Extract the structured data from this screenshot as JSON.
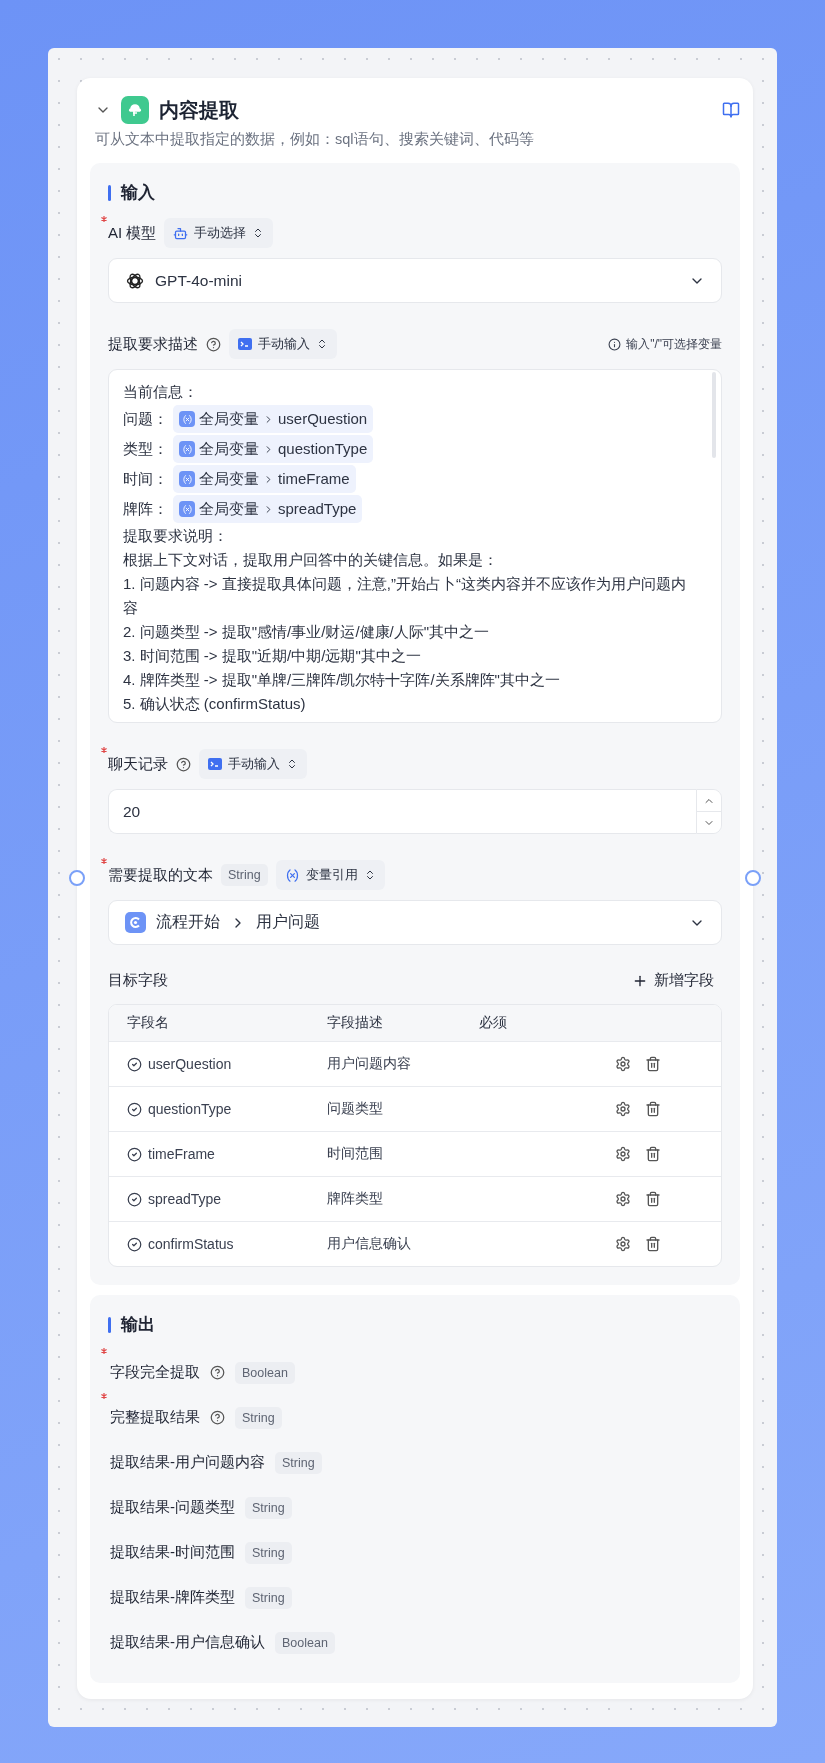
{
  "node": {
    "title": "内容提取",
    "description": "可从文本中提取指定的数据，例如：sql语句、搜索关键词、代码等"
  },
  "input": {
    "title": "输入",
    "ai_model": {
      "label": "AI 模型",
      "required": true,
      "mode": "手动选择",
      "value": "GPT-4o-mini"
    },
    "prompt": {
      "label": "提取要求描述",
      "required": false,
      "mode": "手动输入",
      "hint": "输入\"/\"可选择变量",
      "lines": [
        {
          "kind": "text",
          "text": "当前信息："
        },
        {
          "kind": "variable",
          "label": "问题：",
          "scope": "全局变量",
          "name": "userQuestion"
        },
        {
          "kind": "variable",
          "label": "类型：",
          "scope": "全局变量",
          "name": "questionType"
        },
        {
          "kind": "variable",
          "label": "时间：",
          "scope": "全局变量",
          "name": "timeFrame"
        },
        {
          "kind": "variable",
          "label": "牌阵：",
          "scope": "全局变量",
          "name": "spreadType"
        },
        {
          "kind": "text",
          "text": "提取要求说明："
        },
        {
          "kind": "text",
          "text": "根据上下文对话，提取用户回答中的关键信息。如果是："
        },
        {
          "kind": "text",
          "text": "1. 问题内容 -> 直接提取具体问题，注意,”开始占卜“这类内容并不应该作为用户问题内容"
        },
        {
          "kind": "text",
          "text": "2. 问题类型 -> 提取\"感情/事业/财运/健康/人际\"其中之一"
        },
        {
          "kind": "text",
          "text": "3. 时间范围 -> 提取\"近期/中期/远期\"其中之一"
        },
        {
          "kind": "text",
          "text": "4. 牌阵类型 -> 提取\"单牌/三牌阵/凯尔特十字阵/关系牌阵\"其中之一"
        },
        {
          "kind": "text",
          "text": "5. 确认状态 (confirmStatus)"
        }
      ]
    },
    "history": {
      "label": "聊天记录",
      "required": true,
      "mode": "手动输入",
      "value": "20"
    },
    "source_text": {
      "label": "需要提取的文本",
      "required": true,
      "type": "String",
      "mode": "变量引用",
      "source": "流程开始",
      "value": "用户问题"
    },
    "target_fields": {
      "title": "目标字段",
      "add_label": "新增字段",
      "columns": [
        "字段名",
        "字段描述",
        "必须"
      ],
      "rows": [
        {
          "name": "userQuestion",
          "description": "用户问题内容"
        },
        {
          "name": "questionType",
          "description": "问题类型"
        },
        {
          "name": "timeFrame",
          "description": "时间范围"
        },
        {
          "name": "spreadType",
          "description": "牌阵类型"
        },
        {
          "name": "confirmStatus",
          "description": "用户信息确认"
        }
      ]
    }
  },
  "output": {
    "title": "输出",
    "items": [
      {
        "label": "字段完全提取",
        "required": true,
        "help": true,
        "type": "Boolean"
      },
      {
        "label": "完整提取结果",
        "required": true,
        "help": true,
        "type": "String"
      },
      {
        "label": "提取结果-用户问题内容",
        "required": false,
        "help": false,
        "type": "String"
      },
      {
        "label": "提取结果-问题类型",
        "required": false,
        "help": false,
        "type": "String"
      },
      {
        "label": "提取结果-时间范围",
        "required": false,
        "help": false,
        "type": "String"
      },
      {
        "label": "提取结果-牌阵类型",
        "required": false,
        "help": false,
        "type": "String"
      },
      {
        "label": "提取结果-用户信息确认",
        "required": false,
        "help": false,
        "type": "Boolean"
      }
    ]
  }
}
